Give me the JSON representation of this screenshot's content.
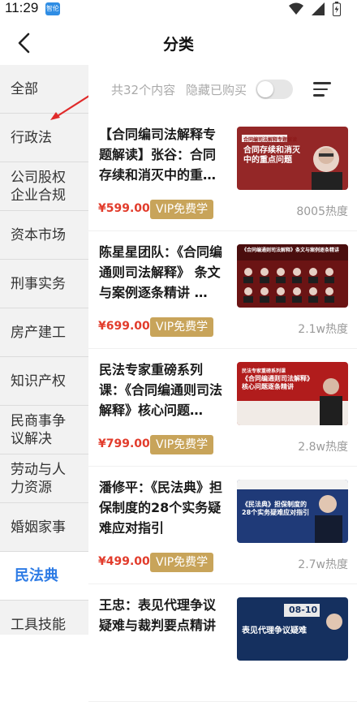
{
  "status": {
    "time": "11:29",
    "app_badge": "智伦"
  },
  "header": {
    "title": "分类"
  },
  "sidebar": {
    "items": [
      {
        "label": "全部"
      },
      {
        "label": "行政法"
      },
      {
        "label": "公司股权企业合规"
      },
      {
        "label": "资本市场"
      },
      {
        "label": "刑事实务"
      },
      {
        "label": "房产建工"
      },
      {
        "label": "知识产权"
      },
      {
        "label": "民商事争议解决"
      },
      {
        "label": "劳动与人力资源"
      },
      {
        "label": "婚姻家事"
      },
      {
        "label": "民法典"
      },
      {
        "label": "工具技能"
      }
    ],
    "active_label": "民法典"
  },
  "toolbar": {
    "total": "共32个内容",
    "hide_bought": "隐藏已购买",
    "toggle_on": false
  },
  "courses": [
    {
      "title": "【合同编司法解释专题解读】张谷：合同存续和消灭中的重…",
      "price": "¥599.00",
      "vip": "VIP免费学",
      "heat": "8005热度",
      "thumb": {
        "bg": "#8e1a1a",
        "banner": "合同编司法解释专题解读",
        "headline": "合同存续和消灭中的重点问题"
      }
    },
    {
      "title": "陈星星团队：《合同编通则司法解释》 条文与案例逐条精讲 …",
      "price": "¥699.00",
      "vip": "VIP免费学",
      "heat": "2.1w热度",
      "thumb": {
        "bg": "#6b1414",
        "banner": "《合同编通则司法解释》条文与案例逐条精讲"
      }
    },
    {
      "title": "民法专家重磅系列课：《合同编通则司法解释》核心问题…",
      "price": "¥799.00",
      "vip": "VIP免费学",
      "heat": "2.8w热度",
      "thumb": {
        "bg": "#b11c1c",
        "banner": "民法专家重磅系列课",
        "headline": "《合同编通则司法解释》核心问题逐条精讲"
      }
    },
    {
      "title": "潘修平：《民法典》担保制度的28个实务疑难应对指引",
      "price": "¥499.00",
      "vip": "VIP免费学",
      "heat": "2.7w热度",
      "thumb": {
        "bg": "#1f3a78",
        "headline": "《民法典》担保制度的28个实务疑难应对指引"
      }
    },
    {
      "title": "王忠：表见代理争议疑难与裁判要点精讲",
      "price": "",
      "vip": "",
      "heat": "",
      "thumb": {
        "bg": "#15305f",
        "date": "08-10",
        "headline": "表见代理争议疑难"
      }
    }
  ]
}
